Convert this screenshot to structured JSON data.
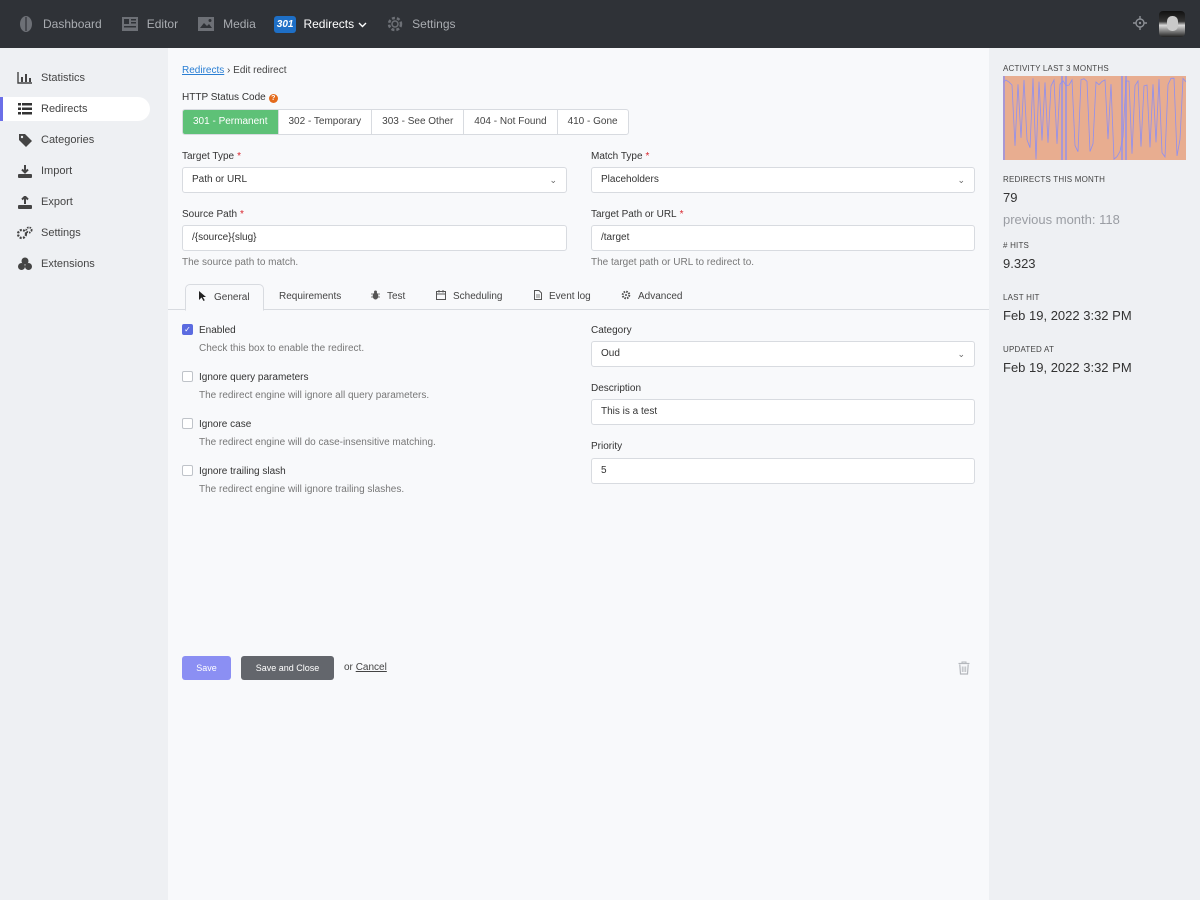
{
  "topnav": {
    "items": [
      {
        "label": "Dashboard",
        "icon": "leaf-icon"
      },
      {
        "label": "Editor",
        "icon": "newspaper-icon"
      },
      {
        "label": "Media",
        "icon": "image-icon"
      },
      {
        "label": "Redirects",
        "icon": "redirect-301-icon",
        "badge": "301",
        "active": true
      },
      {
        "label": "Settings",
        "icon": "gear-icon"
      }
    ]
  },
  "sidebar": {
    "items": [
      {
        "label": "Statistics",
        "icon": "bar-chart-icon"
      },
      {
        "label": "Redirects",
        "icon": "list-icon",
        "active": true
      },
      {
        "label": "Categories",
        "icon": "tag-icon"
      },
      {
        "label": "Import",
        "icon": "download-icon"
      },
      {
        "label": "Export",
        "icon": "upload-icon"
      },
      {
        "label": "Settings",
        "icon": "gears-icon"
      },
      {
        "label": "Extensions",
        "icon": "cubes-icon"
      }
    ]
  },
  "breadcrumb": {
    "link": "Redirects",
    "sep": "›",
    "current": "Edit redirect"
  },
  "status": {
    "label": "HTTP Status Code",
    "help": "?",
    "options": [
      "301 - Permanent",
      "302 - Temporary",
      "303 - See Other",
      "404 - Not Found",
      "410 - Gone"
    ],
    "selected": "301 - Permanent"
  },
  "form": {
    "target_type": {
      "label": "Target Type",
      "required": "*",
      "value": "Path or URL"
    },
    "match_type": {
      "label": "Match Type",
      "required": "*",
      "value": "Placeholders"
    },
    "source_path": {
      "label": "Source Path",
      "required": "*",
      "value": "/{source}{slug}",
      "hint": "The source path to match."
    },
    "target_path": {
      "label": "Target Path or URL",
      "required": "*",
      "value": "/target",
      "hint": "The target path or URL to redirect to."
    }
  },
  "tabs": [
    {
      "label": "General",
      "icon": "cursor-icon",
      "active": true
    },
    {
      "label": "Requirements",
      "icon": ""
    },
    {
      "label": "Test",
      "icon": "bug-icon"
    },
    {
      "label": "Scheduling",
      "icon": "calendar-icon"
    },
    {
      "label": "Event log",
      "icon": "file-icon"
    },
    {
      "label": "Advanced",
      "icon": "cog-icon"
    }
  ],
  "general": {
    "checks": [
      {
        "label": "Enabled",
        "hint": "Check this box to enable the redirect.",
        "checked": true
      },
      {
        "label": "Ignore query parameters",
        "hint": "The redirect engine will ignore all query parameters.",
        "checked": false
      },
      {
        "label": "Ignore case",
        "hint": "The redirect engine will do case-insensitive matching.",
        "checked": false
      },
      {
        "label": "Ignore trailing slash",
        "hint": "The redirect engine will ignore trailing slashes.",
        "checked": false
      }
    ],
    "category": {
      "label": "Category",
      "value": "Oud"
    },
    "description": {
      "label": "Description",
      "value": "This is a test"
    },
    "priority": {
      "label": "Priority",
      "value": "5"
    }
  },
  "actions": {
    "save": "Save",
    "save_close": "Save and Close",
    "or": "or",
    "cancel": "Cancel"
  },
  "stats": {
    "activity_label": "ACTIVITY LAST 3 MONTHS",
    "redirects_month_label": "REDIRECTS THIS MONTH",
    "redirects_month_value": "79",
    "previous_month": "previous month: 118",
    "hits_label": "# HITS",
    "hits_value": "9.323",
    "last_hit_label": "LAST HIT",
    "last_hit_value": "Feb 19, 2022 3:32 PM",
    "updated_label": "UPDATED AT",
    "updated_value": "Feb 19, 2022 3:32 PM"
  },
  "colors": {
    "primary": "#8b8ff3",
    "success": "#5ec177",
    "topbar": "#2f3237",
    "accent_border": "#6b6fe8",
    "spark_fill": "#e8ad90",
    "spark_line": "#8f8ff0"
  }
}
